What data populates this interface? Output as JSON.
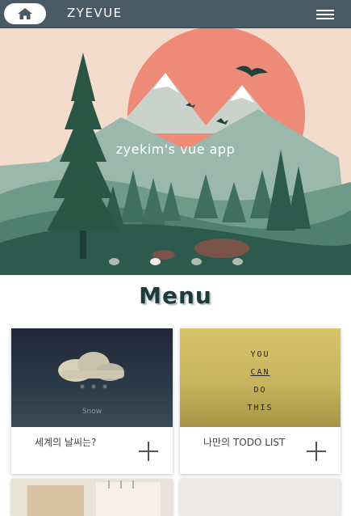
{
  "header": {
    "brand": "ZYEVUE",
    "home_icon": "home-icon",
    "menu_icon": "hamburger-menu-icon"
  },
  "hero": {
    "title": "zyekim's vue app",
    "slide_count": 4,
    "active_slide": 2
  },
  "section": {
    "title": "Menu"
  },
  "cards": [
    {
      "label": "세계의 날씨는?",
      "image_caption": "Snow",
      "icon": "cloud-icon"
    },
    {
      "label": "나만의 TODO LIST",
      "image_text": [
        "YOU",
        "CAN",
        "DO",
        "THIS"
      ]
    }
  ],
  "colors": {
    "topbar": "#4a5a64",
    "hero_bg": "#f4dccd",
    "sun": "#ee8a78",
    "forest": "#2c5a4c",
    "menu_title": "#1e3a3a",
    "weather_bg": "#25303f",
    "todo_bg": "#d0bd63"
  }
}
